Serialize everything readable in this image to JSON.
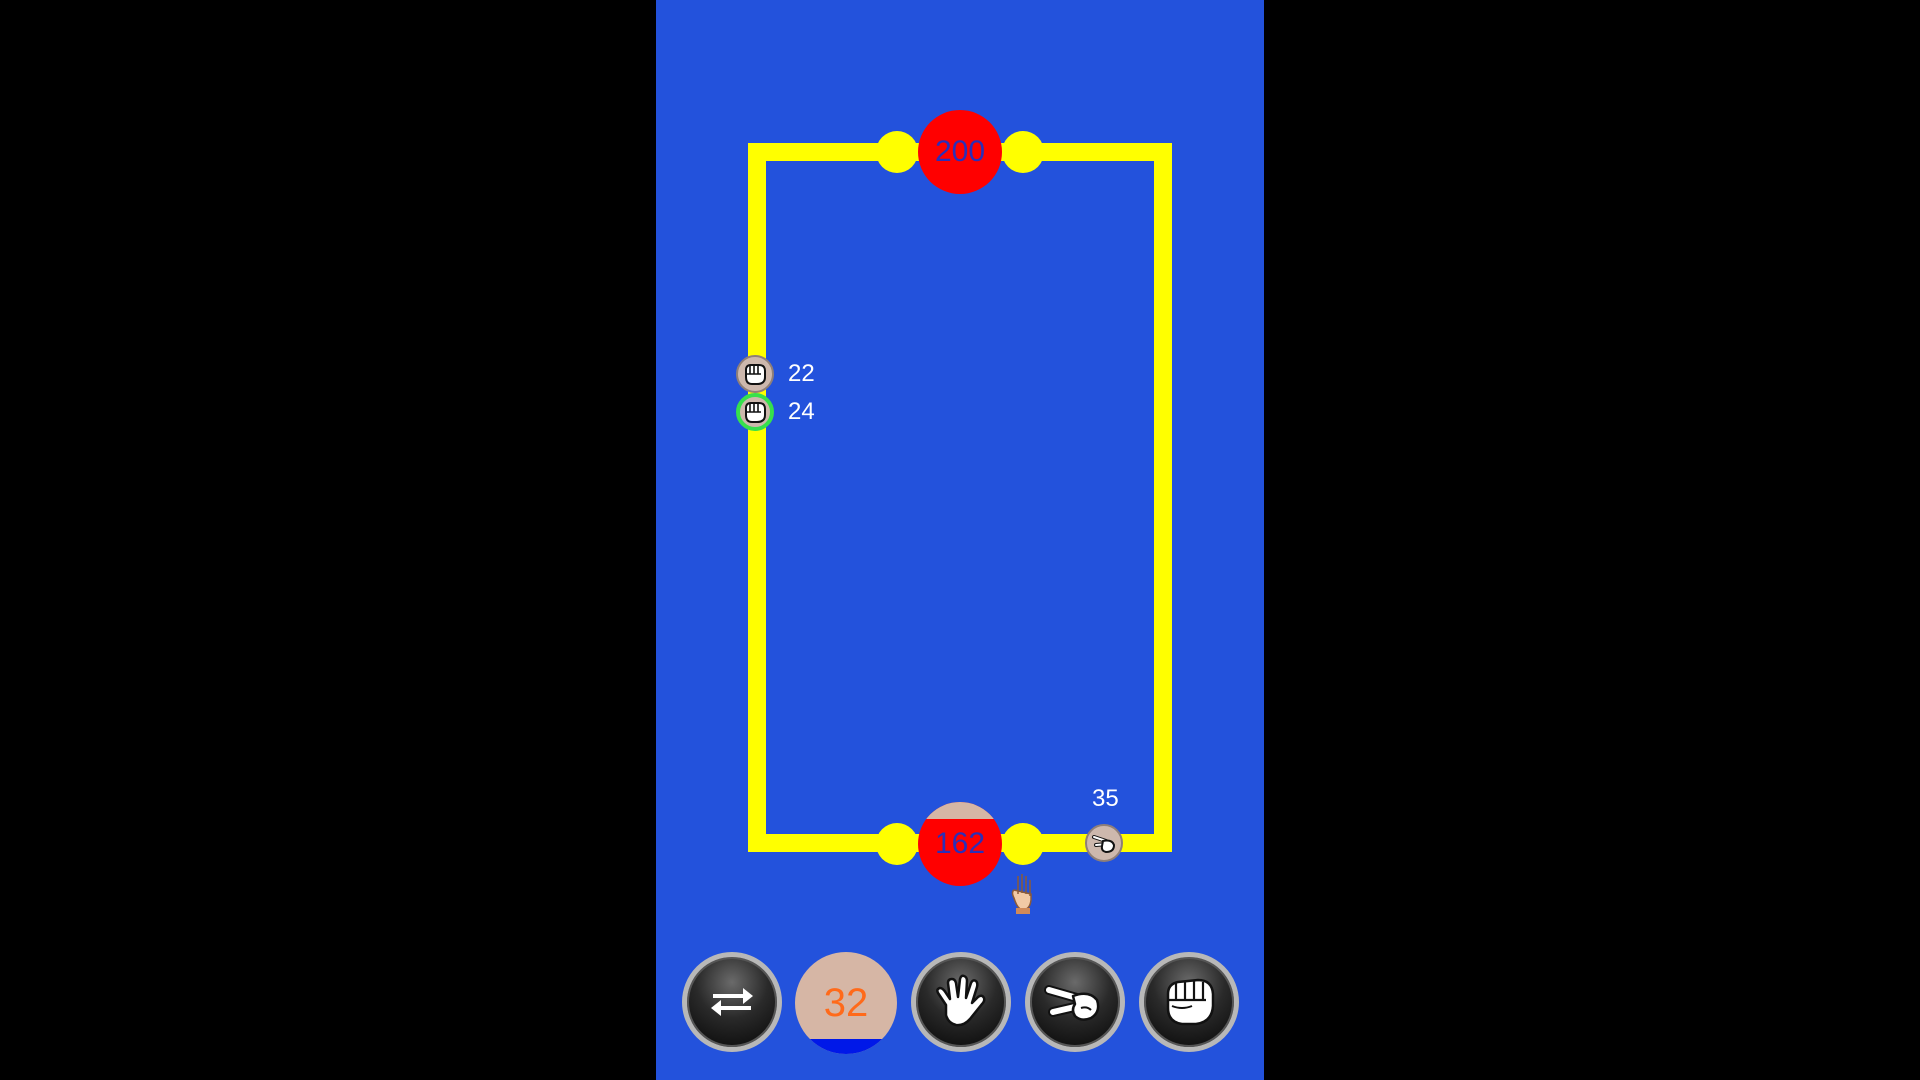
{
  "colors": {
    "background": "#000000",
    "board": "#2352dc",
    "track": "#ffff00",
    "base": "#ff0000",
    "base_text": "#2b2fb8",
    "unit_text": "#ffffff",
    "counter_text": "#ff6a1a",
    "selected_ring": "#36e04c"
  },
  "bases": {
    "top": {
      "value": "200",
      "fill_fraction": 0.0
    },
    "bottom": {
      "value": "162",
      "fill_fraction": 0.2
    }
  },
  "units": [
    {
      "icon": "rock-icon",
      "count": "22",
      "selected": false
    },
    {
      "icon": "rock-icon",
      "count": "24",
      "selected": true
    },
    {
      "icon": "scissors-icon",
      "count": "35",
      "selected": false
    }
  ],
  "cursor_icon": "hand-pointer-icon",
  "toolbar": {
    "swap_icon": "swap-arrows-icon",
    "counter_value": "32",
    "counter_fill_fraction": 0.15,
    "paper_icon": "paper-hand-icon",
    "scissors_icon": "scissors-hand-icon",
    "rock_icon": "rock-hand-icon"
  }
}
